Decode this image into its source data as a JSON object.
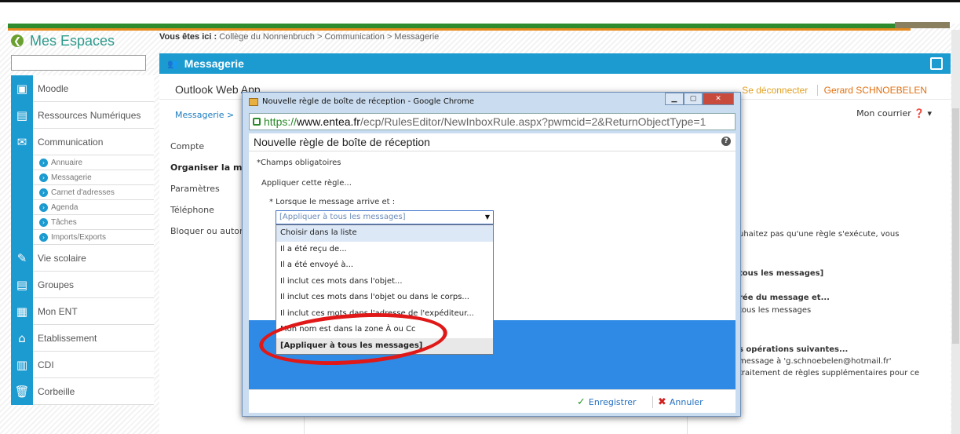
{
  "header": {
    "brand": "Mes Espaces",
    "breadcrumb_label": "Vous êtes ici :",
    "breadcrumb_path": "Collège du Nonnenbruch > Communication > Messagerie"
  },
  "sidebar": {
    "items": [
      {
        "label": "Moodle",
        "icon": "moodle-icon"
      },
      {
        "label": "Ressources Numériques",
        "icon": "resources-icon"
      },
      {
        "label": "Communication",
        "icon": "communication-icon"
      }
    ],
    "subitems": [
      "Annuaire",
      "Messagerie",
      "Carnet d'adresses",
      "Agenda",
      "Tâches",
      "Imports/Exports"
    ],
    "items2": [
      {
        "label": "Vie scolaire",
        "icon": "school-icon"
      },
      {
        "label": "Groupes",
        "icon": "groups-icon"
      },
      {
        "label": "Mon ENT",
        "icon": "ent-icon"
      },
      {
        "label": "Etablissement",
        "icon": "home-icon"
      },
      {
        "label": "CDI",
        "icon": "library-icon"
      },
      {
        "label": "Corbeille",
        "icon": "trash-icon"
      }
    ]
  },
  "panel": {
    "title": "Messagerie",
    "owa_logo": "Outlook Web App",
    "logout": "Se déconnecter",
    "user": "Gerard SCHNOEBELEN",
    "crumb": "Messagerie >",
    "mail": "Mon courrier",
    "nav": [
      "Compte",
      "Organiser la messagerie",
      "Paramètres",
      "Téléphone",
      "Bloquer ou autoriser"
    ]
  },
  "right_pane": {
    "line1": "uhaitez pas qu'une règle s'exécute, vous",
    "line2": "tous les messages]",
    "line3": "rée du message et...",
    "line4": "tous les messages",
    "line5": "s opérations suivantes...",
    "line6": "message à 'g.schnoebelen@hotmail.fr'",
    "line7": "traitement de règles supplémentaires pour ce"
  },
  "popup": {
    "window_title": "Nouvelle règle de boîte de réception - Google Chrome",
    "url_scheme": "https://",
    "url_host": "www.entea.fr",
    "url_path": "/ecp/RulesEditor/NewInboxRule.aspx?pwmcid=2&ReturnObjectType=1",
    "dialog_title": "Nouvelle règle de boîte de réception",
    "required": "*Champs obligatoires",
    "apply": "Appliquer cette règle...",
    "when": "* Lorsque le message arrive et :",
    "selected": "[Appliquer à tous les messages]",
    "options": [
      "Choisir dans la liste",
      "Il a été reçu de...",
      "Il a été envoyé à...",
      "Il inclut ces mots dans l'objet...",
      "Il inclut ces mots dans l'objet ou dans le corps...",
      "Il inclut ces mots dans l'adresse de l'expéditeur...",
      "Mon nom est dans la zone À ou Cc",
      "[Appliquer à tous les messages]"
    ],
    "save": "Enregistrer",
    "cancel": "Annuler"
  },
  "colors": {
    "accent": "#1c9bd0",
    "highlight": "#2f8ae6",
    "annotation": "#e01818"
  }
}
